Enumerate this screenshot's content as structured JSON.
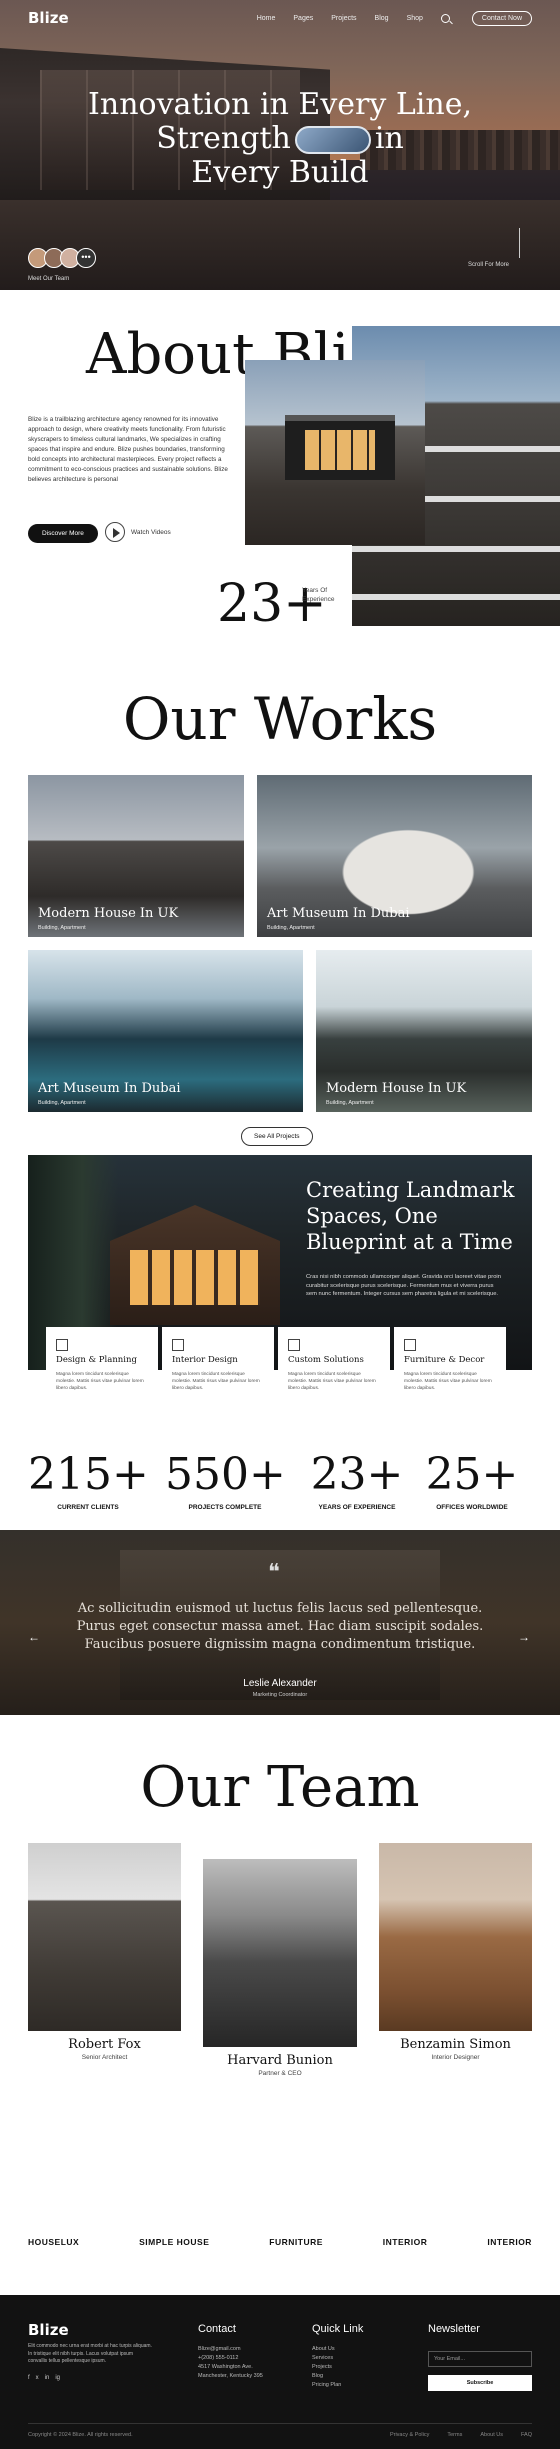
{
  "nav": {
    "logo": "Blize",
    "links": [
      "Home",
      "Pages",
      "Projects",
      "Blog",
      "Shop"
    ],
    "contact": "Contact Now"
  },
  "hero": {
    "line1": "Innovation in Every Line,",
    "line2a": "Strength",
    "line2b": "in",
    "line3": "Every Build",
    "meet": "Meet Our Team",
    "scroll": "Scroll For More"
  },
  "about": {
    "title": "About Blize",
    "desc": "Blize is a trailblazing architecture agency renowned for its innovative approach to design, where creativity meets functionality. From futuristic skyscrapers to timeless cultural landmarks, We specializes in crafting spaces that inspire and endure. Blize pushes boundaries, transforming bold concepts into architectural masterpieces. Every project reflects a commitment to eco-conscious practices and sustainable solutions. Blize believes architecture is personal",
    "btn": "Discover More",
    "watch": "Watch Videos",
    "years_num": "23+",
    "years_label1": "Years Of",
    "years_label2": "Experience"
  },
  "works": {
    "title": "Our Works",
    "items": [
      {
        "title": "Modern House In UK",
        "sub": "Building, Apartment"
      },
      {
        "title": "Art Museum In Dubai",
        "sub": "Building, Apartment"
      },
      {
        "title": "Art Museum In Dubai",
        "sub": "Building, Apartment"
      },
      {
        "title": "Modern House In UK",
        "sub": "Building, Apartment"
      }
    ],
    "see_all": "See All Projects"
  },
  "landmark": {
    "title": "Creating Landmark Spaces, One Blueprint at a Time",
    "desc": "Cras nisi nibh commodo ullamcorper aliquet. Gravida orci laoreet vitae proin curabitur scelerisque purus scelerisque. Fermentum mus et viverra purus sem nunc fermentum. Integer cursus sem pharetra ligula et mi scelerisque.",
    "services": [
      {
        "name": "Design & Planning",
        "desc": "Magna lorem tincidunt scelerisque molestie. Mattis risus vitae pulvinar lorem libero dapibus."
      },
      {
        "name": "Interior Design",
        "desc": "Magna lorem tincidunt scelerisque molestie. Mattis risus vitae pulvinar lorem libero dapibus."
      },
      {
        "name": "Custom Solutions",
        "desc": "Magna lorem tincidunt scelerisque molestie. Mattis risus vitae pulvinar lorem libero dapibus."
      },
      {
        "name": "Furniture & Decor",
        "desc": "Magna lorem tincidunt scelerisque molestie. Mattis risus vitae pulvinar lorem libero dapibus."
      }
    ]
  },
  "stats": [
    {
      "value": "215+",
      "label": "CURRENT CLIENTS"
    },
    {
      "value": "550+",
      "label": "PROJECTS COMPLETE"
    },
    {
      "value": "23+",
      "label": "YEARS OF EXPERIENCE"
    },
    {
      "value": "25+",
      "label": "OFFICES WORLDWIDE"
    }
  ],
  "testimonial": {
    "quote": "Ac sollicitudin euismod ut luctus felis lacus sed pellentesque. Purus eget consectur massa amet. Hac diam suscipit sodales. Faucibus posuere dignissim magna condimentum tristique.",
    "name": "Leslie Alexander",
    "role": "Marketing Coordinator"
  },
  "team": {
    "title": "Our Team",
    "members": [
      {
        "name": "Robert Fox",
        "role": "Senior Architect"
      },
      {
        "name": "Harvard Bunion",
        "role": "Partner & CEO"
      },
      {
        "name": "Benzamin Simon",
        "role": "Interior Designer"
      }
    ]
  },
  "brands": [
    "HOUSELUX",
    "SIMPLE HOUSE",
    "FURNITURE",
    "INTERIOR",
    "INTERIOR"
  ],
  "footer": {
    "logo": "Blize",
    "desc": "Elit commodo nec urna erat morbi at hac turpis aliquam. In tristique elit nibh turpis. Lacus volutpat ipsum convallis tellus pellentesque ipsum.",
    "social": [
      "f",
      "x",
      "in",
      "ig"
    ],
    "contact_title": "Contact",
    "contact_lines": [
      "Blize@gmail.com",
      "+(208) 555-0112",
      "4517 Washington Ave.",
      "Manchester, Kentucky 395"
    ],
    "quick_title": "Quick Link",
    "quick_links": [
      "About Us",
      "Services",
      "Projects",
      "Blog",
      "Pricing Plan"
    ],
    "news_title": "Newsletter",
    "email_placeholder": "Your Email...",
    "subscribe": "Subscribe",
    "copyright": "Copyright © 2024 Blize. All rights reserved.",
    "bottom_links": [
      "Privacy & Policy",
      "Terms",
      "About Us",
      "FAQ"
    ]
  }
}
